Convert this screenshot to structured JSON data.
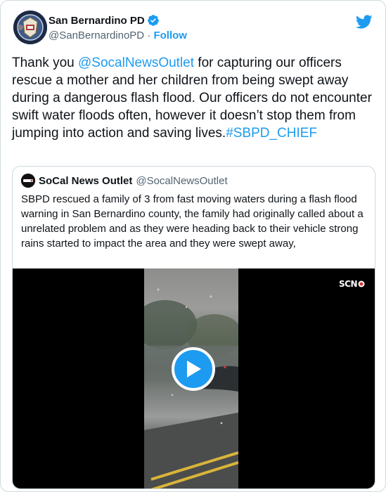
{
  "tweet": {
    "display_name": "San Bernardino PD",
    "handle": "@SanBernardinoPD",
    "separator": " · ",
    "follow_label": "Follow",
    "text": {
      "part1": "Thank you ",
      "mention": "@SocalNewsOutlet",
      "part2": " for capturing our officers rescue a mother and her children from being swept away during a dangerous flash flood. Our officers do not encounter swift water floods often, however it doesn’t stop them from jumping into action and saving lives.",
      "hashtag": "#SBPD_CHIEF"
    }
  },
  "quoted_tweet": {
    "display_name": "SoCal News Outlet",
    "handle": "@SocalNewsOutlet",
    "text": "SBPD rescued a family of 3 from fast moving waters during a flash flood warning in San Bernardino county, the family had originally called about a unrelated problem and as they were heading back to their vehicle strong rains started to impact the area and they were swept away,",
    "media": {
      "watermark": "SCN",
      "play_icon": "play-icon"
    }
  },
  "colors": {
    "accent": "#1d9bf0",
    "text": "#0f1419",
    "secondary": "#536471",
    "border": "#cfd9de"
  },
  "icons": [
    "verified-badge-icon",
    "twitter-bird-icon",
    "play-icon"
  ]
}
